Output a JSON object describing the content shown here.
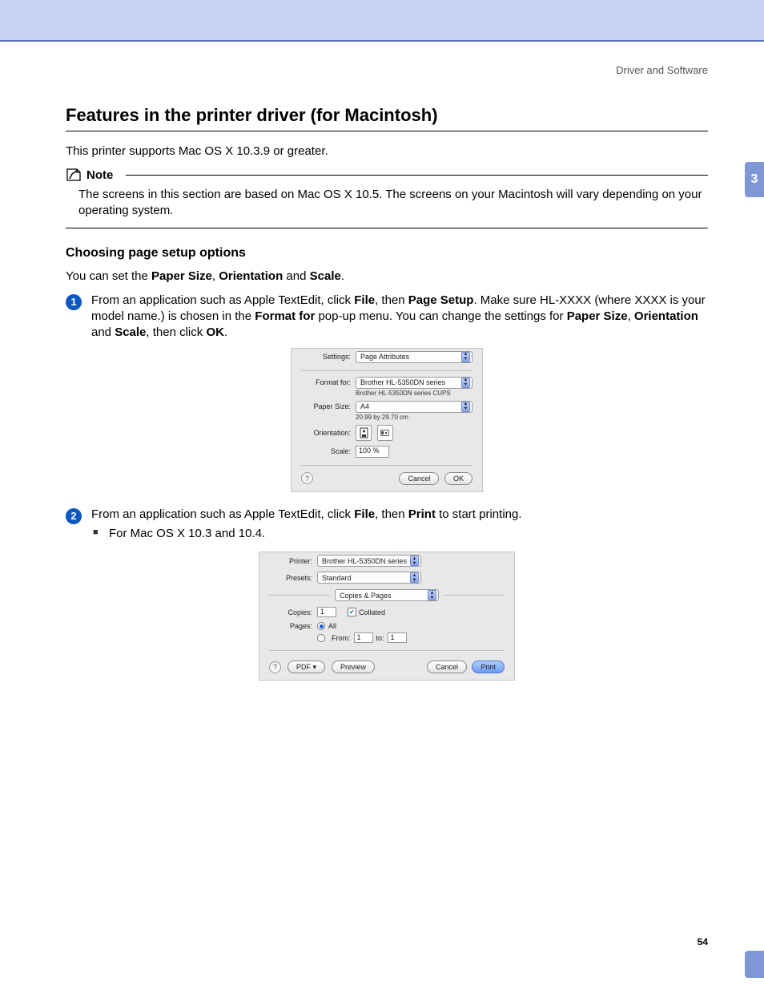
{
  "header": {
    "running_head": "Driver and Software"
  },
  "title": "Features in the printer driver (for Macintosh)",
  "intro": "This printer supports Mac OS X 10.3.9 or greater.",
  "note": {
    "label": "Note",
    "body": "The screens in this section are based on Mac OS X 10.5. The screens on your Macintosh will vary depending on your operating system."
  },
  "subhead": "Choosing page setup options",
  "lead_pre": "You can set the ",
  "lead_b1": "Paper Size",
  "lead_b2": "Orientation",
  "lead_b3": "Scale",
  "step1": {
    "num": "1",
    "t1": "From an application such as Apple TextEdit, click ",
    "b1": "File",
    "t2": ", then ",
    "b2": "Page Setup",
    "t3": ". Make sure HL-XXXX (where XXXX is your model name.) is chosen in the ",
    "b3": "Format for",
    "t4": " pop-up menu. You can change the settings for ",
    "b4": "Paper Size",
    "b5": "Orientation",
    "b6": "Scale",
    "t5": ", then click ",
    "b7": "OK",
    "t6": "."
  },
  "step2": {
    "num": "2",
    "t1": "From an application such as Apple TextEdit, click ",
    "b1": "File",
    "t2": ", then ",
    "b2": "Print",
    "t3": " to start printing.",
    "bullet": "For Mac OS X 10.3 and 10.4."
  },
  "dialog_page_setup": {
    "settings_label": "Settings:",
    "settings_value": "Page Attributes",
    "format_for_label": "Format for:",
    "format_for_value": "Brother HL-5350DN series",
    "format_for_sub": "Brother HL-5350DN series CUPS",
    "paper_size_label": "Paper Size:",
    "paper_size_value": "A4",
    "paper_size_sub": "20.99 by 29.70 cm",
    "orientation_label": "Orientation:",
    "scale_label": "Scale:",
    "scale_value": "100 %",
    "cancel": "Cancel",
    "ok": "OK"
  },
  "dialog_print": {
    "printer_label": "Printer:",
    "printer_value": "Brother HL-5350DN series",
    "presets_label": "Presets:",
    "presets_value": "Standard",
    "section_value": "Copies & Pages",
    "copies_label": "Copies:",
    "copies_value": "1",
    "collated_label": "Collated",
    "pages_label": "Pages:",
    "pages_all": "All",
    "pages_from": "From:",
    "pages_from_value": "1",
    "pages_to": "to:",
    "pages_to_value": "1",
    "pdf": "PDF ▾",
    "preview": "Preview",
    "cancel": "Cancel",
    "print": "Print"
  },
  "side_tab": "3",
  "page_number": "54"
}
